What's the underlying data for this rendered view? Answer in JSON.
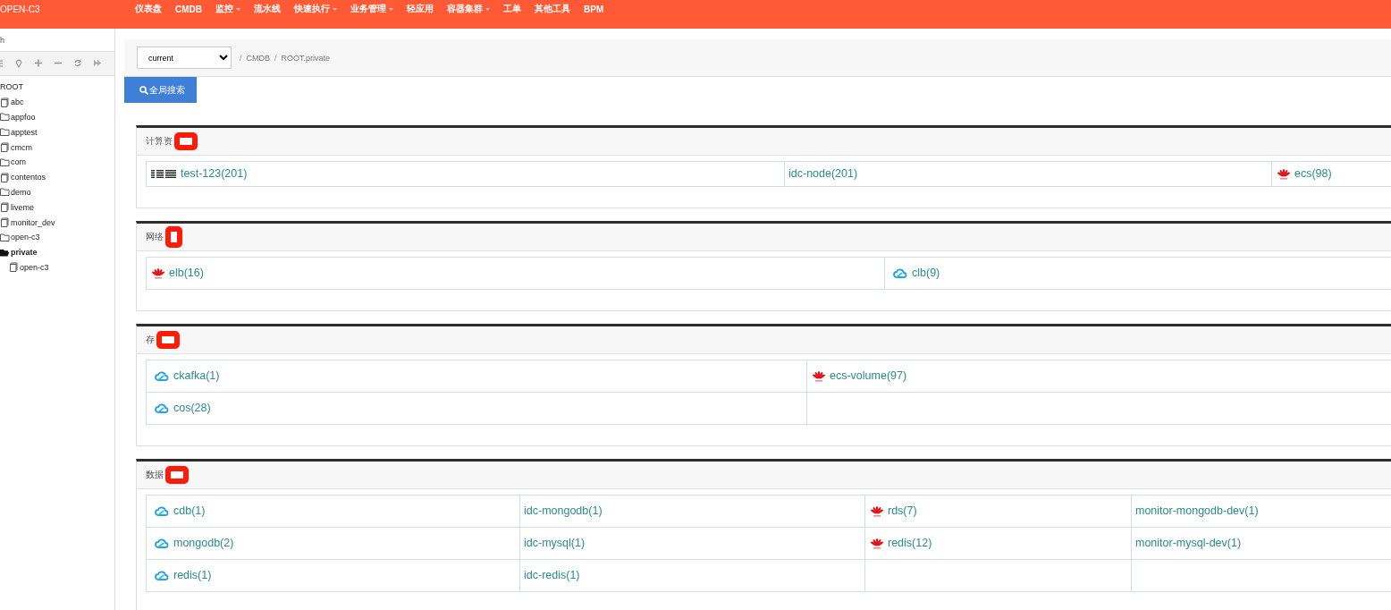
{
  "brand": "OPEN-C3",
  "nav": [
    {
      "label": "仪表盘",
      "dropdown": false
    },
    {
      "label": "CMDB",
      "dropdown": false
    },
    {
      "label": "监控",
      "dropdown": true
    },
    {
      "label": "流水线",
      "dropdown": false
    },
    {
      "label": "快速执行",
      "dropdown": true
    },
    {
      "label": "业务管理",
      "dropdown": true
    },
    {
      "label": "轻应用",
      "dropdown": false
    },
    {
      "label": "容器集群",
      "dropdown": true
    },
    {
      "label": "工单",
      "dropdown": false
    },
    {
      "label": "其他工具",
      "dropdown": false
    },
    {
      "label": "BPM",
      "dropdown": false
    }
  ],
  "sidebar": {
    "search": {
      "placeholder": "h"
    },
    "tree": [
      {
        "label": "ROOT",
        "selected": false,
        "children": [
          {
            "label": "abc",
            "kind": "leaf",
            "selected": false
          },
          {
            "label": "appfoo",
            "kind": "folder",
            "selected": false
          },
          {
            "label": "apptest",
            "kind": "folder",
            "selected": false
          },
          {
            "label": "cmcm",
            "kind": "leaf",
            "selected": false
          },
          {
            "label": "com",
            "kind": "folder",
            "selected": false
          },
          {
            "label": "contentos",
            "kind": "leaf",
            "selected": false
          },
          {
            "label": "demo",
            "kind": "folder",
            "selected": false
          },
          {
            "label": "liveme",
            "kind": "leaf",
            "selected": false
          },
          {
            "label": "monitor_dev",
            "kind": "leaf",
            "selected": false
          },
          {
            "label": "open-c3",
            "kind": "folder",
            "selected": false
          },
          {
            "label": "private",
            "kind": "open-folder",
            "selected": true,
            "children": [
              {
                "label": "open-c3",
                "kind": "leaf",
                "selected": false
              }
            ]
          }
        ]
      }
    ]
  },
  "breadcrumb": {
    "select": "current",
    "path": [
      {
        "separator": "/",
        "label": "CMDB"
      },
      {
        "separator": "/",
        "label": "ROOT.private"
      }
    ]
  },
  "search_button": "全局搜索",
  "sections": [
    {
      "title": "计算资",
      "redacted": true,
      "rows": [
        [
          {
            "label": "test-123(201)",
            "kind": "ibm"
          },
          {
            "label": "idc-node(201)",
            "kind": "none"
          },
          {
            "label": "ecs(98)",
            "kind": "huawei"
          }
        ]
      ]
    },
    {
      "title": "网络",
      "redacted": true,
      "rows": [
        [
          {
            "label": "elb(16)",
            "kind": "huawei"
          },
          {
            "label": "clb(9)",
            "kind": "cloud"
          }
        ]
      ]
    },
    {
      "title": "存",
      "redacted": true,
      "rows": [
        [
          {
            "label": "ckafka(1)",
            "kind": "cloud"
          },
          {
            "label": "ecs-volume(97)",
            "kind": "huawei"
          }
        ],
        [
          {
            "label": "cos(28)",
            "kind": "cloud"
          }
        ]
      ]
    },
    {
      "title": "数据",
      "redacted": true,
      "rows": [
        [
          {
            "label": "cdb(1)",
            "kind": "cloud"
          },
          {
            "label": "idc-mongodb(1)",
            "kind": "none"
          },
          {
            "label": "rds(7)",
            "kind": "huawei"
          },
          {
            "label": "monitor-mongodb-dev(1)",
            "kind": "none"
          }
        ],
        [
          {
            "label": "mongodb(2)",
            "kind": "cloud"
          },
          {
            "label": "idc-mysql(1)",
            "kind": "none"
          },
          {
            "label": "redis(12)",
            "kind": "huawei"
          },
          {
            "label": "monitor-mysql-dev(1)",
            "kind": "none"
          }
        ],
        [
          {
            "label": "redis(1)",
            "kind": "cloud"
          },
          {
            "label": "idc-redis(1)",
            "kind": "none"
          }
        ]
      ]
    }
  ]
}
